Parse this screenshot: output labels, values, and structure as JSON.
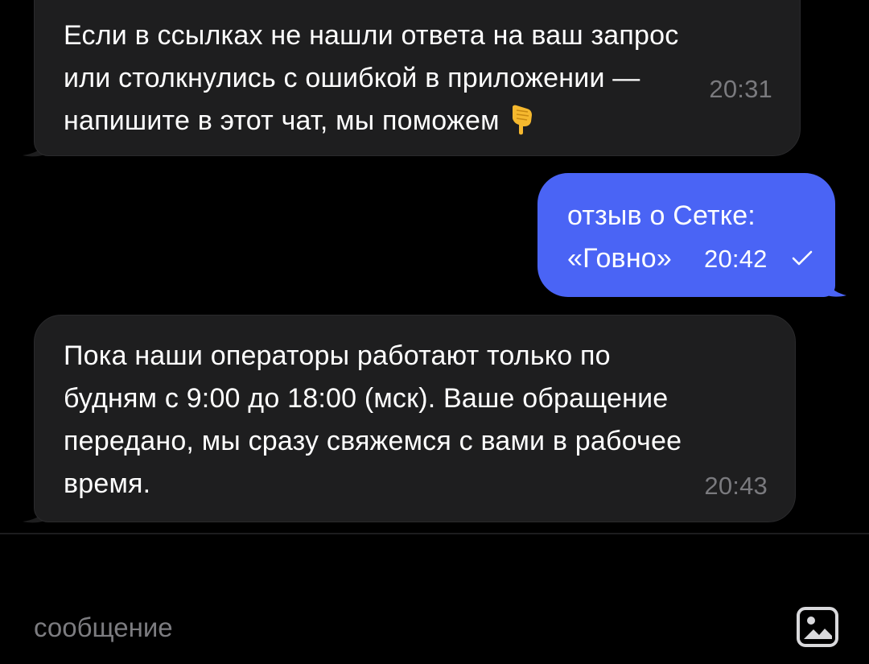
{
  "colors": {
    "background": "#000000",
    "incoming_bubble": "#1e1e1f",
    "outgoing_bubble": "#4a64f5",
    "timestamp_incoming": "#7a7a7e",
    "placeholder": "#7c7c80"
  },
  "messages": [
    {
      "direction": "incoming",
      "text": "Если в ссылках не нашли ответа на ваш запрос\nили столкнулись с ошибкой в приложении —\nнапишите в этот чат, мы поможем",
      "emoji": "backhand-index-pointing-down",
      "time": "20:31"
    },
    {
      "direction": "outgoing",
      "text": "отзыв о Сетке:\n«Говно»",
      "time": "20:42",
      "status_icon": "check-icon"
    },
    {
      "direction": "incoming",
      "text": "Пока наши операторы работают только по\nбудням с 9:00 до 18:00 (мск). Ваше обращение\nпередано, мы сразу свяжемся с вами в рабочее\nвремя.",
      "time": "20:43"
    }
  ],
  "composer": {
    "placeholder": "сообщение",
    "value": "",
    "attach_icon": "image-attach-icon"
  }
}
